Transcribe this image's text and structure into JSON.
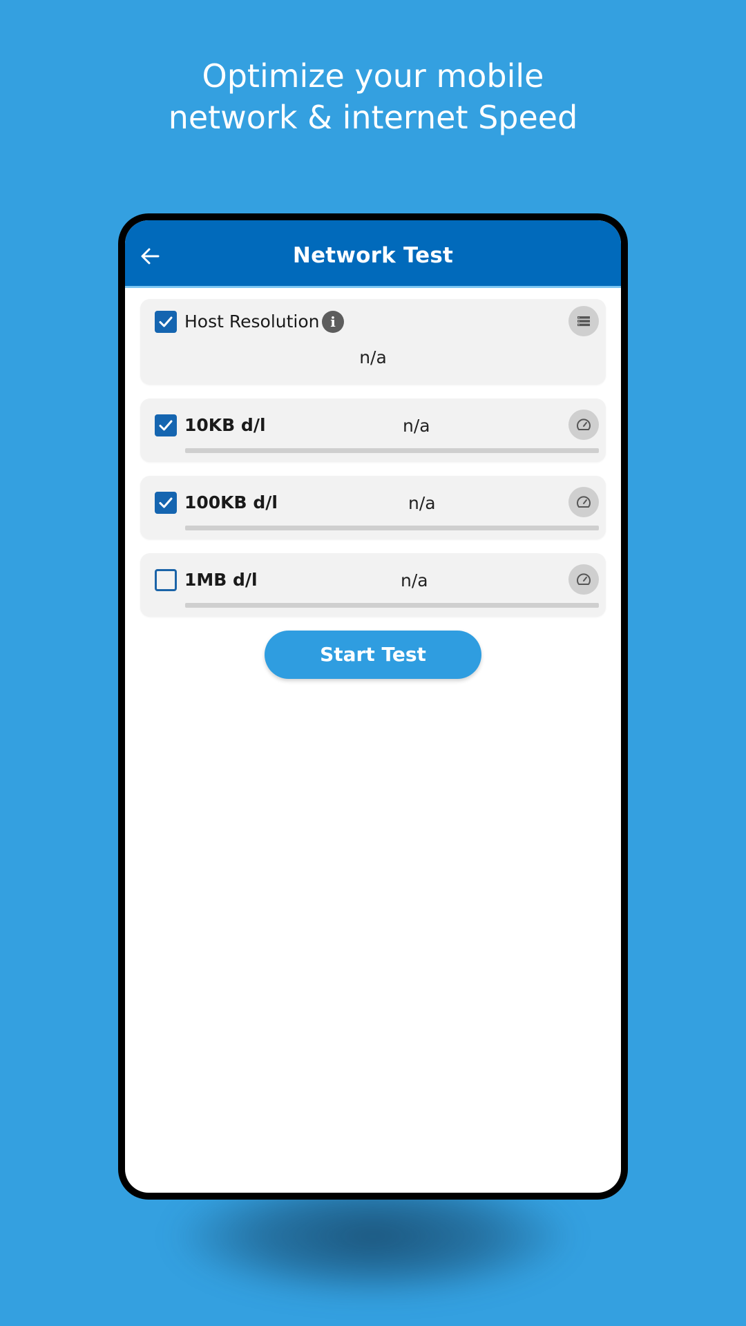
{
  "promo": {
    "line1": "Optimize your mobile",
    "line2": "network & internet Speed"
  },
  "appbar": {
    "title": "Network Test",
    "back_icon": "arrow-left-icon",
    "color": "#016abb"
  },
  "host_resolution": {
    "label": "Host Resolution",
    "checked": true,
    "value": "n/a",
    "info_icon": "info-icon",
    "action_icon": "list-icon"
  },
  "tests": [
    {
      "label": "10KB d/l",
      "checked": true,
      "value": "n/a",
      "progress": 0,
      "action_icon": "speedometer-icon"
    },
    {
      "label": "100KB d/l",
      "checked": true,
      "value": "n/a",
      "progress": 0,
      "action_icon": "speedometer-icon"
    },
    {
      "label": "1MB d/l",
      "checked": false,
      "value": "n/a",
      "progress": 0,
      "action_icon": "speedometer-icon"
    }
  ],
  "start_button": {
    "label": "Start Test",
    "color": "#2f9de0"
  },
  "colors": {
    "background": "#34a0e0",
    "checkbox": "#1565b0"
  }
}
